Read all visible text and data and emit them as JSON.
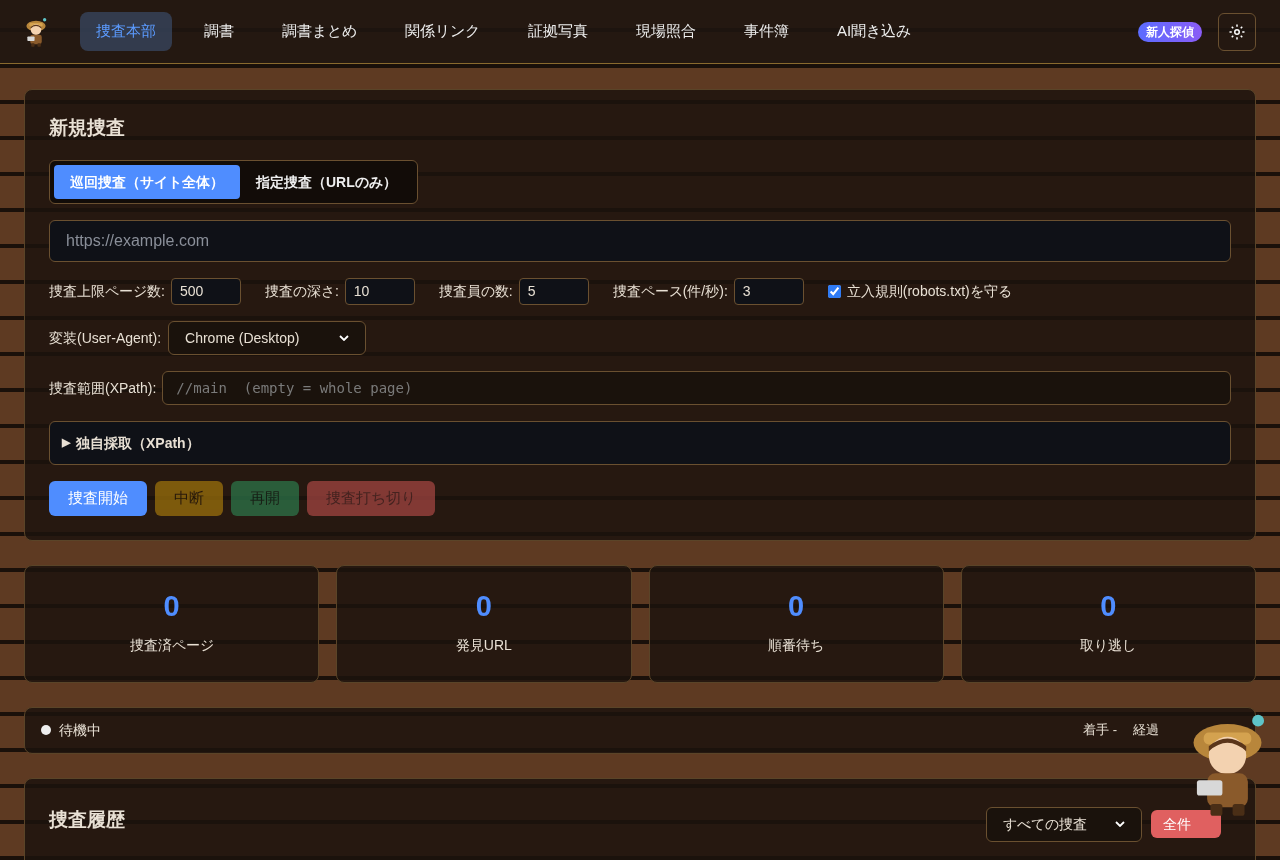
{
  "nav": {
    "tabs": [
      {
        "label": "捜査本部",
        "selected": true
      },
      {
        "label": "調書",
        "selected": false
      },
      {
        "label": "調書まとめ",
        "selected": false
      },
      {
        "label": "関係リンク",
        "selected": false
      },
      {
        "label": "証拠写真",
        "selected": false
      },
      {
        "label": "現場照合",
        "selected": false
      },
      {
        "label": "事件簿",
        "selected": false
      },
      {
        "label": "AI聞き込み",
        "selected": false
      }
    ],
    "rank_badge": "新人探偵"
  },
  "new_search": {
    "title": "新規捜査",
    "modes": [
      {
        "label": "巡回捜査（サイト全体）",
        "selected": true
      },
      {
        "label": "指定捜査（URLのみ）",
        "selected": false
      }
    ],
    "url_field": {
      "placeholder": "https://example.com"
    },
    "params": [
      {
        "label": "捜査上限ページ数:",
        "value": "500"
      },
      {
        "label": "捜査の深さ:",
        "value": "10"
      },
      {
        "label": "捜査員の数:",
        "value": "5"
      },
      {
        "label": "捜査ペース(件/秒):",
        "value": "3"
      }
    ],
    "robots": {
      "label": "立入規則(robots.txt)を守る",
      "checked": true
    },
    "user_agent": {
      "label": "変装(User-Agent):",
      "value": "Chrome (Desktop)"
    },
    "scope": {
      "label": "捜査範囲(XPath):",
      "placeholder": "//main  (empty = whole page)"
    },
    "custom_extract": {
      "marker": "▶",
      "label": "独自採取（XPath）",
      "expanded": false
    },
    "buttons": [
      {
        "label": "捜査開始",
        "kind": "start",
        "disabled": false
      },
      {
        "label": "中断",
        "kind": "pause",
        "disabled": true
      },
      {
        "label": "再開",
        "kind": "resume",
        "disabled": true
      },
      {
        "label": "捜査打ち切り",
        "kind": "stop",
        "disabled": true
      }
    ]
  },
  "stats": [
    {
      "value": "0",
      "label": "捜査済ページ"
    },
    {
      "value": "0",
      "label": "発見URL"
    },
    {
      "value": "0",
      "label": "順番待ち"
    },
    {
      "value": "0",
      "label": "取り逃し"
    }
  ],
  "status": {
    "state": "待機中",
    "started": "着手 -",
    "elapsed": "経過"
  },
  "history": {
    "title": "捜査履歴",
    "filter": "すべての捜査",
    "clear_button": "全件"
  }
}
